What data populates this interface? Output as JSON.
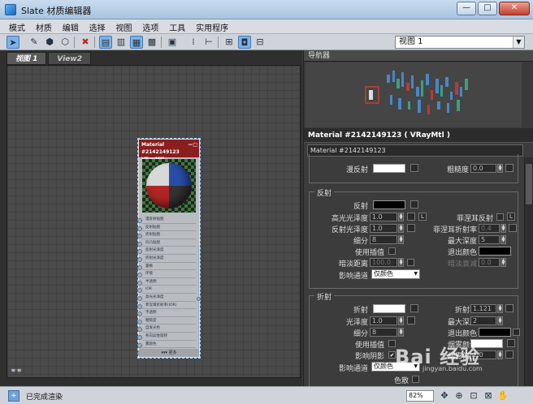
{
  "window": {
    "title": "Slate 材质编辑器",
    "minimize": "—",
    "maximize": "□",
    "close": "✕"
  },
  "menu": [
    "模式",
    "材质",
    "编辑",
    "选择",
    "视图",
    "选项",
    "工具",
    "实用程序"
  ],
  "toolbar": {
    "view_select": "视图 1"
  },
  "tabs": [
    "视图 1",
    "View2"
  ],
  "node": {
    "title": "Material #2142149123",
    "subtitle": "VRayMtl",
    "slots": [
      "漫反射贴图",
      "反射贴图",
      "折射贴图",
      "凹凸贴图",
      "反射光泽度",
      "折射光泽度",
      "置换",
      "环境",
      "半透明",
      "IOR",
      "高光光泽度",
      "菲涅耳折射率(IOR)",
      "不透明",
      "粗糙度",
      "自发光色",
      "各向异性旋转",
      "雾颜色",
      "自发光"
    ],
    "footer": "▾▾▾ 更多"
  },
  "navigator": {
    "title": "导航器"
  },
  "properties": {
    "header": "Material #2142149123  ( VRayMtl )",
    "name": "Material #2142149123",
    "diffuse": {
      "diffuse_label": "漫反射",
      "roughness_label": "粗糙度",
      "roughness_value": "0.0"
    },
    "reflection": {
      "title": "反射",
      "reflect_label": "反射",
      "hilight_gloss_label": "高光光泽度",
      "hilight_gloss_value": "1.0",
      "l_label": "L",
      "fresnel_label": "菲涅耳反射",
      "refl_gloss_label": "反射光泽度",
      "refl_gloss_value": "1.0",
      "fresnel_ior_label": "菲涅耳折射率",
      "fresnel_ior_value": "0.4",
      "subdivs_label": "细分",
      "subdivs_value": "8",
      "max_depth_label": "最大深度",
      "max_depth_value": "5",
      "interp_label": "使用插值",
      "exit_color_label": "退出颜色",
      "dim_dist_label": "暗淡距离",
      "dim_dist_value": "100.0",
      "dim_falloff_label": "暗淡衰减",
      "dim_falloff_value": "0.0",
      "affect_ch_label": "影响通道",
      "affect_ch_value": "仅颜色"
    },
    "refraction": {
      "title": "折射",
      "refract_label": "折射",
      "ior_label": "折射率",
      "ior_value": "1.121",
      "gloss_label": "光泽度",
      "gloss_value": "1.0",
      "max_depth_label": "最大深度",
      "max_depth_value": "2",
      "subdivs_label": "细分",
      "subdivs_value": "8",
      "exit_color_label": "退出颜色",
      "interp_label": "使用插值",
      "fog_color_label": "烟雾颜色",
      "affect_shadows_label": "影响阴影",
      "fog_mult_label": "烟雾倍增",
      "fog_mult_value": "1.0",
      "affect_ch_label": "影响通道",
      "affect_ch_value": "仅颜色",
      "dispersion_label": "色散"
    }
  },
  "status": {
    "text": "已完成渲染",
    "zoom": "82%"
  },
  "watermark": {
    "main": "Bai 经验",
    "sub": "jingyan.baidu.com"
  },
  "colors": {
    "node_header": "#8b1e1e",
    "canvas_bg": "#4a4a4a",
    "active_tool": "#7fb2e8"
  }
}
